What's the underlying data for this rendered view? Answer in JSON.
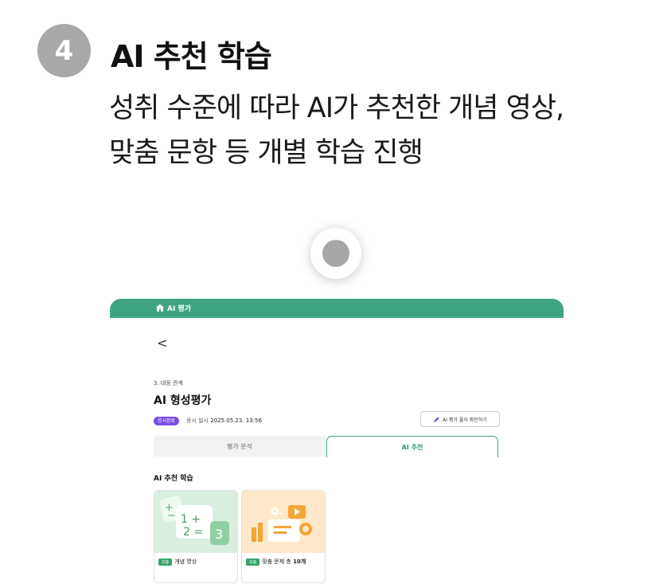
{
  "step": {
    "number": "4",
    "title": "AI 추천 학습",
    "description_line1": "성취 수준에 따라 AI가 추천한 개념 영상,",
    "description_line2": "맞춤 문항 등 개별 학습 진행"
  },
  "app": {
    "header_title": "AI 평가",
    "back_label": "<",
    "breadcrumb": "3. 대등 관계",
    "page_title": "AI 형성평가",
    "status_badge": "응시완료",
    "meta_label": "응시 일시",
    "meta_date": "2025.05.23. 13:56",
    "review_button": "AI 평가 풀이 확인하기",
    "tabs": [
      "평가 분석",
      "AI 추천"
    ],
    "section_title": "AI 추천 학습",
    "cards": [
      {
        "tag": "보충",
        "label": "개념 영상"
      },
      {
        "tag": "보충",
        "label_prefix": "맞춤 문제 총 ",
        "label_bold": "10개"
      }
    ]
  },
  "colors": {
    "accent": "#3fa581",
    "badge_purple": "#7b4de3",
    "step_gray": "#a8a8a8"
  }
}
